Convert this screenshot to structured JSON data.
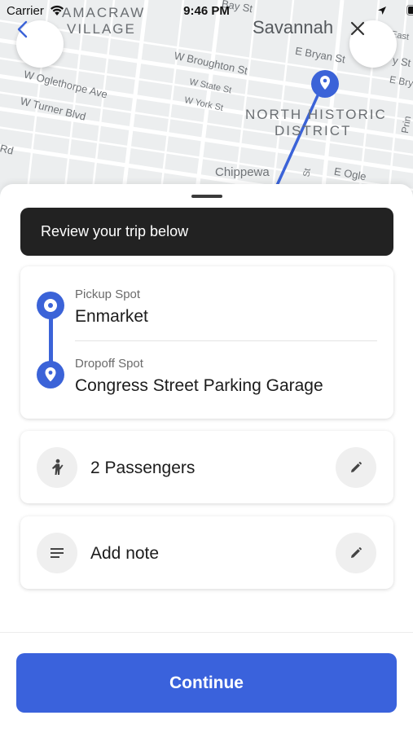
{
  "status_bar": {
    "carrier": "Carrier",
    "time": "9:46 PM",
    "icons": [
      "wifi-icon",
      "location-arrow-icon",
      "battery-icon"
    ]
  },
  "map": {
    "labels": {
      "yamacraw": "AMACRAW",
      "village": "VILLAGE",
      "city": "Savannah",
      "district_1": "NORTH HISTORIC",
      "district_2": "DISTRICT",
      "bay_st": "Bay St",
      "bryan_st": "E Bryan St",
      "bryan_st_right": "E Bryan",
      "broughton": "W Broughton St",
      "state_st": "W State St",
      "york_st": "W York St",
      "oglethorpe": "W Oglethorpe Ave",
      "turner": "W Turner Blvd",
      "rd": "Rd",
      "chippewa": "Chippewa",
      "e_oglethorpe": "E Ogle",
      "east": "East",
      "st_right": "y St",
      "vertical": "St",
      "prince": "Prin"
    },
    "route_color": "#3b63d8",
    "back_icon": "chevron-left-icon",
    "close_icon": "close-icon"
  },
  "sheet": {
    "banner": "Review your trip below",
    "pickup": {
      "label": "Pickup Spot",
      "name": "Enmarket"
    },
    "dropoff": {
      "label": "Dropoff Spot",
      "name": "Congress Street Parking Garage"
    },
    "passengers": {
      "text": "2 Passengers",
      "icon": "person-icon",
      "edit_icon": "pencil-icon"
    },
    "note": {
      "text": "Add note",
      "icon": "notes-icon",
      "edit_icon": "pencil-icon"
    },
    "continue": "Continue"
  },
  "colors": {
    "accent": "#3a62dc",
    "banner_bg": "#222222"
  }
}
